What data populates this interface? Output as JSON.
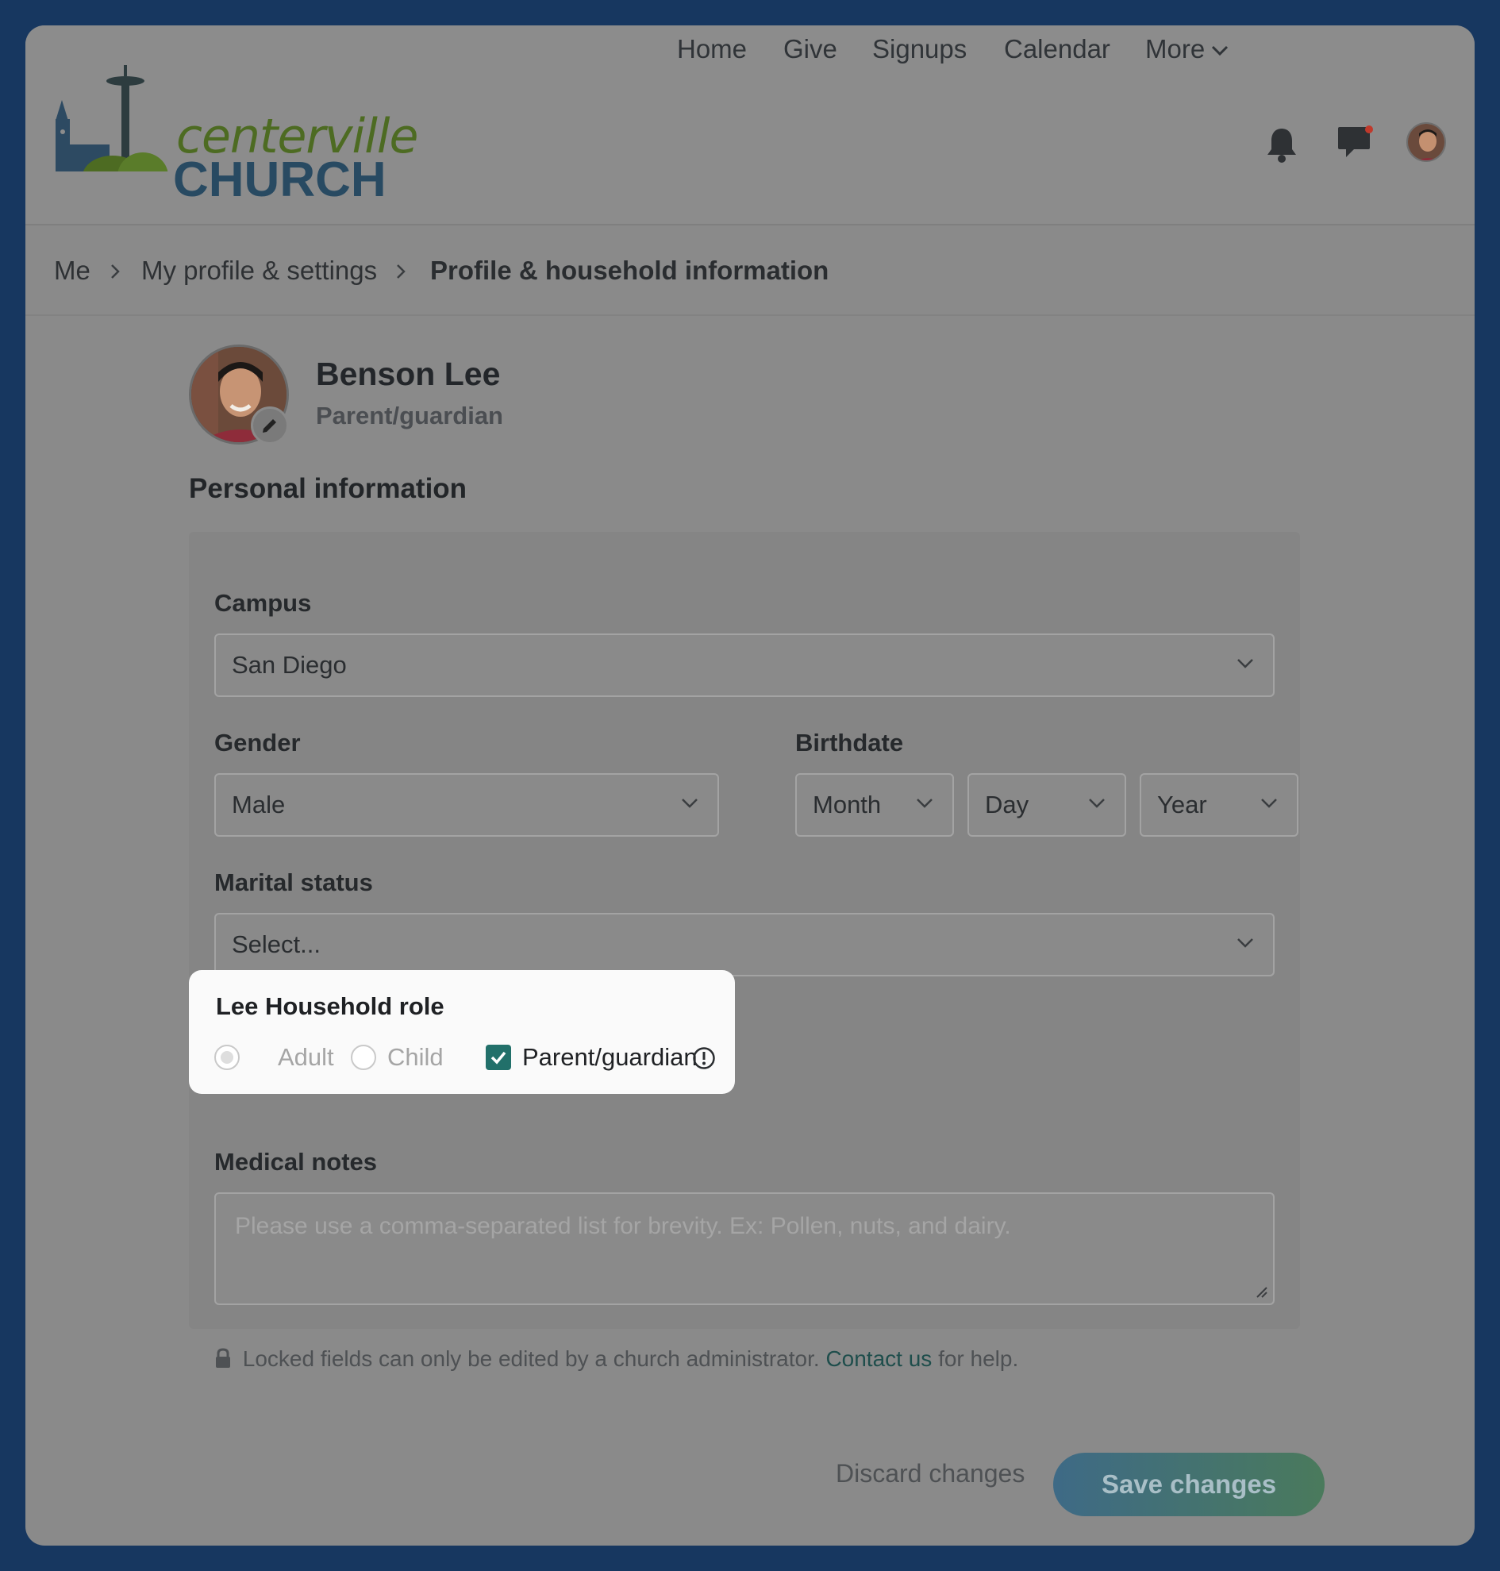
{
  "brand": {
    "logo_top": "centerville",
    "logo_bottom": "CHURCH"
  },
  "nav": {
    "items": [
      {
        "label": "Home"
      },
      {
        "label": "Give"
      },
      {
        "label": "Signups"
      },
      {
        "label": "Calendar"
      },
      {
        "label": "More"
      }
    ],
    "icons": [
      "bell-icon",
      "chat-icon",
      "user-avatar"
    ]
  },
  "breadcrumb": {
    "items": [
      "Me",
      "My profile & settings",
      "Profile & household information"
    ]
  },
  "profile": {
    "name": "Benson Lee",
    "role": "Parent/guardian"
  },
  "section_title": "Personal information",
  "form": {
    "campus": {
      "label": "Campus",
      "value": "San Diego"
    },
    "gender": {
      "label": "Gender",
      "value": "Male"
    },
    "birthdate": {
      "label": "Birthdate",
      "month": "Month",
      "day": "Day",
      "year": "Year"
    },
    "marital_status": {
      "label": "Marital status",
      "value": "Select..."
    },
    "household_role": {
      "title": "Lee Household role",
      "options": [
        {
          "label": "Adult",
          "selected": true,
          "disabled": true
        },
        {
          "label": "Child",
          "selected": false,
          "disabled": true
        }
      ],
      "parent_guardian": {
        "label": "Parent/guardian",
        "checked": true
      }
    },
    "medical_notes": {
      "label": "Medical notes",
      "placeholder": "Please use a comma-separated list for brevity. Ex: Pollen, nuts, and dairy."
    }
  },
  "locked_note": {
    "text_before": "Locked fields can only be edited by a church administrator.",
    "link": "Contact us",
    "text_after": "for help."
  },
  "actions": {
    "discard": "Discard changes",
    "save": "Save changes"
  },
  "colors": {
    "page_bg": "#173760",
    "accent_teal": "#22706a",
    "logo_green": "#4d6b22",
    "logo_blue": "#284a62"
  }
}
